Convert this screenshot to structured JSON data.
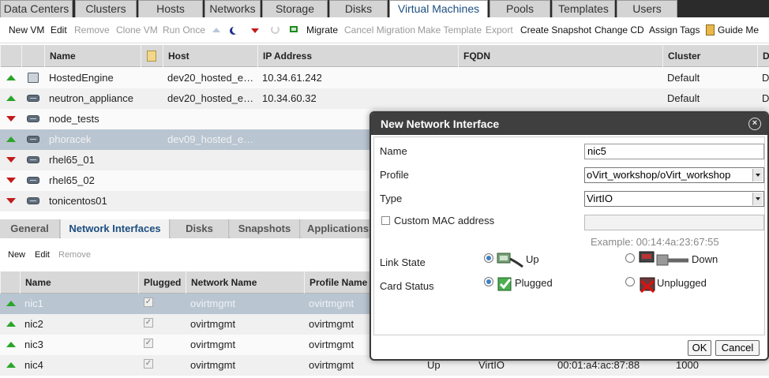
{
  "top_tabs": [
    "Data Centers",
    "Clusters",
    "Hosts",
    "Networks",
    "Storage",
    "Disks",
    "Virtual Machines",
    "Pools",
    "Templates",
    "Users"
  ],
  "toolbar": {
    "new_vm": "New VM",
    "edit": "Edit",
    "remove": "Remove",
    "clone_vm": "Clone VM",
    "run_once": "Run Once",
    "migrate": "Migrate",
    "cancel_migration": "Cancel Migration",
    "make_template": "Make Template",
    "export": "Export",
    "create_snapshot": "Create Snapshot",
    "change_cd": "Change CD",
    "assign_tags": "Assign Tags",
    "guide_me": "Guide Me"
  },
  "vm_grid": {
    "headers": {
      "name": "Name",
      "host": "Host",
      "ip": "IP Address",
      "fqdn": "FQDN",
      "cluster": "Cluster",
      "dc": "D"
    },
    "rows": [
      {
        "status": "up",
        "name": "HostedEngine",
        "host": "dev20_hosted_e…",
        "ip": "10.34.61.242",
        "cluster": "Default",
        "dc": "D"
      },
      {
        "status": "up",
        "name": "neutron_appliance",
        "host": "dev20_hosted_e…",
        "ip": "10.34.60.32",
        "cluster": "Default",
        "dc": "D"
      },
      {
        "status": "down",
        "name": "node_tests",
        "host": "",
        "ip": "",
        "cluster": "",
        "dc": ""
      },
      {
        "status": "up",
        "name": "phoracek",
        "host": "dev09_hosted_e…",
        "ip": "",
        "cluster": "",
        "dc": ""
      },
      {
        "status": "down",
        "name": "rhel65_01",
        "host": "",
        "ip": "",
        "cluster": "",
        "dc": ""
      },
      {
        "status": "down",
        "name": "rhel65_02",
        "host": "",
        "ip": "",
        "cluster": "",
        "dc": ""
      },
      {
        "status": "down",
        "name": "tonicentos01",
        "host": "",
        "ip": "",
        "cluster": "",
        "dc": ""
      }
    ]
  },
  "sub_tabs": [
    "General",
    "Network Interfaces",
    "Disks",
    "Snapshots",
    "Applications"
  ],
  "sub_toolbar": {
    "new": "New",
    "edit": "Edit",
    "remove": "Remove"
  },
  "nic_grid": {
    "headers": {
      "name": "Name",
      "plugged": "Plugged",
      "network": "Network Name",
      "profile": "Profile Name"
    },
    "rows": [
      {
        "name": "nic1",
        "network": "ovirtmgmt",
        "profile": "ovirtmgmt",
        "extra1": "",
        "extra2": "",
        "extra3": "",
        "extra4": ""
      },
      {
        "name": "nic2",
        "network": "ovirtmgmt",
        "profile": "ovirtmgmt",
        "extra1": "",
        "extra2": "",
        "extra3": "",
        "extra4": ""
      },
      {
        "name": "nic3",
        "network": "ovirtmgmt",
        "profile": "ovirtmgmt",
        "extra1": "",
        "extra2": "",
        "extra3": "",
        "extra4": ""
      },
      {
        "name": "nic4",
        "network": "ovirtmgmt",
        "profile": "ovirtmgmt",
        "extra1": "Up",
        "extra2": "VirtIO",
        "extra3": "00:01:a4:ac:87:88",
        "extra4": "1000"
      }
    ]
  },
  "dialog": {
    "title": "New Network Interface",
    "name_label": "Name",
    "name_value": "nic5",
    "profile_label": "Profile",
    "profile_value": "oVirt_workshop/oVirt_workshop",
    "type_label": "Type",
    "type_value": "VirtIO",
    "custom_mac_label": "Custom MAC address",
    "mac_value": "",
    "mac_example": "Example: 00:14:4a:23:67:55",
    "link_state_label": "Link State",
    "link_up": "Up",
    "link_down": "Down",
    "card_status_label": "Card Status",
    "card_plugged": "Plugged",
    "card_unplugged": "Unplugged",
    "ok": "OK",
    "cancel": "Cancel"
  },
  "colors": {
    "status_up": "#2aa52a",
    "status_down": "#c21b1b",
    "selected_row": "#b9c5d1",
    "active_tab_text": "#1c4e80"
  }
}
